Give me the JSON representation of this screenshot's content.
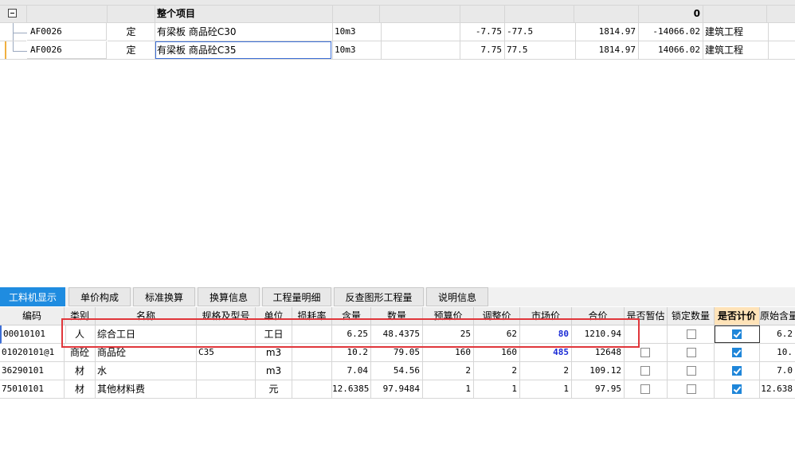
{
  "top_grid": {
    "group_row": {
      "name": "整个项目",
      "total": "0"
    },
    "rows": [
      {
        "code": "AF0026",
        "type": "定",
        "name": "有梁板 商品砼C30",
        "unit": "10m3",
        "qty": "-7.75",
        "qty2": "-77.5",
        "price": "1814.97",
        "total": "-14066.02",
        "category": "建筑工程"
      },
      {
        "code": "AF0026",
        "type": "定",
        "name": "有梁板 商品砼C35",
        "unit": "10m3",
        "qty": "7.75",
        "qty2": "77.5",
        "price": "1814.97",
        "total": "14066.02",
        "category": "建筑工程"
      }
    ]
  },
  "tabs": [
    "工料机显示",
    "单价构成",
    "标准换算",
    "换算信息",
    "工程量明细",
    "反查图形工程量",
    "说明信息"
  ],
  "columns": [
    "编码",
    "类别",
    "名称",
    "规格及型号",
    "单位",
    "损耗率",
    "含量",
    "数量",
    "预算价",
    "调整价",
    "市场价",
    "合价",
    "是否暂估",
    "锁定数量",
    "是否计价",
    "原始含量"
  ],
  "rows": [
    {
      "code": "00010101",
      "type": "人",
      "name": "综合工日",
      "spec": "",
      "unit": "工日",
      "loss": "",
      "content": "6.25",
      "qty": "48.4375",
      "budget": "25",
      "adjust": "62",
      "market": "80",
      "total": "1210.94",
      "provisional": null,
      "locked": false,
      "priced": true,
      "orig": "6.2"
    },
    {
      "code": "01020101@1",
      "type": "商砼",
      "name": "商品砼",
      "spec": "C35",
      "unit": "m3",
      "loss": "",
      "content": "10.2",
      "qty": "79.05",
      "budget": "160",
      "adjust": "160",
      "market": "485",
      "total": "12648",
      "provisional": false,
      "locked": false,
      "priced": true,
      "orig": "10."
    },
    {
      "code": "36290101",
      "type": "材",
      "name": "水",
      "spec": "",
      "unit": "m3",
      "loss": "",
      "content": "7.04",
      "qty": "54.56",
      "budget": "2",
      "adjust": "2",
      "market": "2",
      "total": "109.12",
      "provisional": false,
      "locked": false,
      "priced": true,
      "orig": "7.0"
    },
    {
      "code": "75010101",
      "type": "材",
      "name": "其他材料费",
      "spec": "",
      "unit": "元",
      "loss": "",
      "content": "12.6385",
      "qty": "97.9484",
      "budget": "1",
      "adjust": "1",
      "market": "1",
      "total": "97.95",
      "provisional": false,
      "locked": false,
      "priced": true,
      "orig": "12.638"
    }
  ],
  "colors": {
    "tab_active": "#1f8ce0",
    "highlight_box": "#e0363b",
    "market_price_text": "#1a2bd6",
    "priced_header": "#ffe3b8"
  }
}
